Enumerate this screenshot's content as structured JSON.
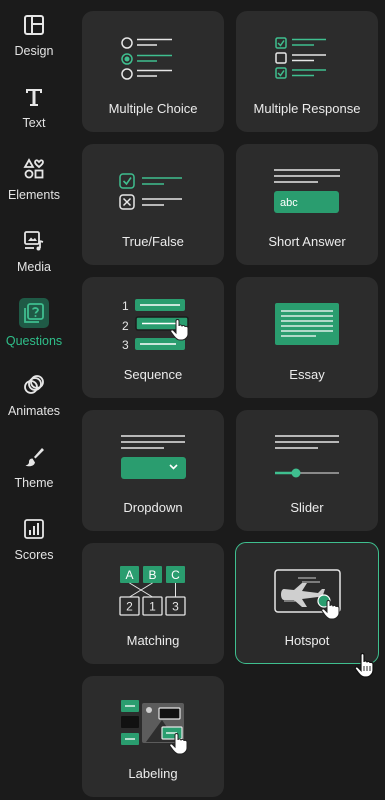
{
  "sidebar": {
    "items": [
      {
        "label": "Design",
        "icon": "layout-icon"
      },
      {
        "label": "Text",
        "icon": "text-t-icon"
      },
      {
        "label": "Elements",
        "icon": "shapes-icon"
      },
      {
        "label": "Media",
        "icon": "media-icon"
      },
      {
        "label": "Questions",
        "icon": "question-icon",
        "active": true
      },
      {
        "label": "Animates",
        "icon": "rings-icon"
      },
      {
        "label": "Theme",
        "icon": "brush-icon"
      },
      {
        "label": "Scores",
        "icon": "chart-icon"
      }
    ]
  },
  "question_types": [
    {
      "label": "Multiple Choice"
    },
    {
      "label": "Multiple Response"
    },
    {
      "label": "True/False"
    },
    {
      "label": "Short Answer",
      "field_text": "abc"
    },
    {
      "label": "Sequence",
      "numbers": [
        "1",
        "2",
        "3"
      ]
    },
    {
      "label": "Essay"
    },
    {
      "label": "Dropdown"
    },
    {
      "label": "Slider"
    },
    {
      "label": "Matching",
      "top_letters": [
        "A",
        "B",
        "C"
      ],
      "bottom_numbers": [
        "2",
        "1",
        "3"
      ]
    },
    {
      "label": "Hotspot",
      "selected": true
    },
    {
      "label": "Labeling"
    }
  ],
  "colors": {
    "accent": "#2a9d6f",
    "accent_light": "#3fbf8f",
    "card_bg": "#2c2c2c",
    "sidebar_bg": "#1b1b1b"
  }
}
